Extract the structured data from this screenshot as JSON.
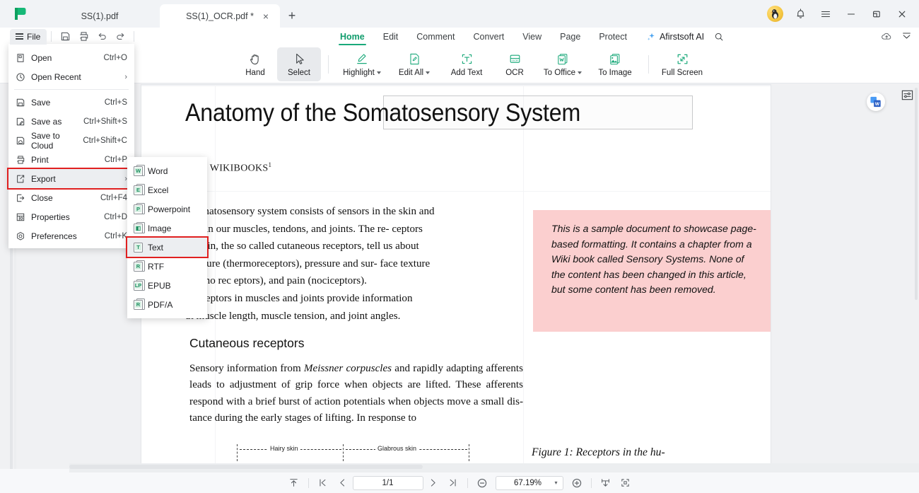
{
  "app": {
    "logo_name": "afirstsoft-logo"
  },
  "tabs": [
    {
      "label": "SS(1).pdf",
      "active": false
    },
    {
      "label": "SS(1)_OCR.pdf *",
      "active": true
    }
  ],
  "tab_new_label": "+",
  "tab_close_label": "×",
  "window_controls": {
    "minimize": "—",
    "maximize": "❐",
    "close": "×"
  },
  "quick_access": {
    "file_label": "File",
    "buttons": [
      "save-icon",
      "print-icon",
      "undo-icon",
      "redo-icon"
    ]
  },
  "menubar": {
    "items": [
      {
        "label": "Home",
        "active": true
      },
      {
        "label": "Edit",
        "active": false
      },
      {
        "label": "Comment",
        "active": false
      },
      {
        "label": "Convert",
        "active": false
      },
      {
        "label": "View",
        "active": false
      },
      {
        "label": "Page",
        "active": false
      },
      {
        "label": "Protect",
        "active": false
      }
    ],
    "ai_label": "Afirstsoft AI"
  },
  "ribbon": {
    "items": [
      {
        "label": "Hand",
        "icon": "hand-icon",
        "caret": false,
        "selected": false
      },
      {
        "label": "Select",
        "icon": "cursor-icon",
        "caret": false,
        "selected": true
      },
      {
        "label": "Highlight",
        "icon": "highlighter-icon",
        "caret": true,
        "selected": false
      },
      {
        "label": "Edit All",
        "icon": "edit-all-icon",
        "caret": true,
        "selected": false
      },
      {
        "label": "Add Text",
        "icon": "add-text-icon",
        "caret": false,
        "selected": false
      },
      {
        "label": "OCR",
        "icon": "ocr-icon",
        "caret": false,
        "selected": false
      },
      {
        "label": "To Office",
        "icon": "to-office-icon",
        "caret": true,
        "selected": false
      },
      {
        "label": "To Image",
        "icon": "to-image-icon",
        "caret": false,
        "selected": false
      },
      {
        "label": "Full Screen",
        "icon": "full-screen-icon",
        "caret": false,
        "selected": false
      }
    ]
  },
  "file_menu": {
    "items": [
      {
        "label": "Open",
        "accel": "Ctrl+O",
        "icon": "open-icon",
        "arrow": false,
        "highlighted": false
      },
      {
        "label": "Open Recent",
        "accel": "",
        "icon": "recent-icon",
        "arrow": true,
        "highlighted": false
      },
      {
        "label": "Save",
        "accel": "Ctrl+S",
        "icon": "save-icon",
        "arrow": false,
        "highlighted": false
      },
      {
        "label": "Save as",
        "accel": "Ctrl+Shift+S",
        "icon": "save-as-icon",
        "arrow": false,
        "highlighted": false
      },
      {
        "label": "Save to Cloud",
        "accel": "Ctrl+Shift+C",
        "icon": "save-cloud-icon",
        "arrow": false,
        "highlighted": false
      },
      {
        "label": "Print",
        "accel": "Ctrl+P",
        "icon": "print-icon",
        "arrow": false,
        "highlighted": false
      },
      {
        "label": "Export",
        "accel": "",
        "icon": "export-icon",
        "arrow": true,
        "highlighted": true
      },
      {
        "label": "Close",
        "accel": "Ctrl+F4",
        "icon": "close-doc-icon",
        "arrow": false,
        "highlighted": false
      },
      {
        "label": "Properties",
        "accel": "Ctrl+D",
        "icon": "properties-icon",
        "arrow": false,
        "highlighted": false
      },
      {
        "label": "Preferences",
        "accel": "Ctrl+K",
        "icon": "preferences-icon",
        "arrow": false,
        "highlighted": false
      }
    ],
    "arrow_glyph": "›"
  },
  "export_submenu": {
    "items": [
      {
        "label": "Word",
        "glyph": "W",
        "highlighted": false
      },
      {
        "label": "Excel",
        "glyph": "E",
        "highlighted": false
      },
      {
        "label": "Powerpoint",
        "glyph": "P",
        "highlighted": false
      },
      {
        "label": "Image",
        "glyph": "◧",
        "highlighted": false
      },
      {
        "label": "Text",
        "glyph": "T",
        "highlighted": true
      },
      {
        "label": "RTF",
        "glyph": "R",
        "highlighted": false
      },
      {
        "label": "EPUB",
        "glyph": "LP",
        "highlighted": false
      },
      {
        "label": "PDF/A",
        "glyph": "R",
        "highlighted": false
      }
    ]
  },
  "document": {
    "title": "Anatomy of the Somatosensory System",
    "source": "OM WIKIBOOKS",
    "source_sup": "1",
    "paragraph1_lines": [
      "r somatosensory system consists of sensors in the skin and",
      "sors in our muscles, tendons, and joints. The re- ceptors",
      "he skin, the so called cutaneous receptors, tell us about",
      "perature (thermoreceptors), pressure and sur- face texture",
      "echano rec eptors), and pain (nociceptors)."
    ],
    "paragraph2_lines": [
      "e receptors in muscles and joints provide information",
      "ut muscle length, muscle tension, and joint angles."
    ],
    "section_heading": "Cutaneous receptors",
    "section_body": "Sensory information from Meissner corpuscles and rapidly adapting afferents leads to adjustment of grip force when objects are lifted. These afferents respond with a brief burst of action potentials when objects move a small dis-tance during the early stages of lifting. In response to",
    "section_body_italic": "Meissner corpuscles",
    "note_text": "This is a sample document to showcase page-based formatting. It contains a chapter from a Wiki book called Sensory Systems. None of the content has been changed in this article, but some content has been removed.",
    "note_color": "#fbcfcf",
    "figure_caption": "Figure 1: Receptors in the hu-",
    "diagram_labels": [
      "Hairy skin",
      "Glabrous skin"
    ]
  },
  "statusbar": {
    "page_value": "1/1",
    "zoom_value": "67.19%",
    "buttons": [
      "scroll-top-icon",
      "first-page-icon",
      "prev-page-icon",
      "next-page-icon",
      "last-page-icon",
      "zoom-out-icon",
      "zoom-in-icon",
      "fit-width-icon",
      "fit-page-icon"
    ],
    "zoom_caret": "▾"
  },
  "colors": {
    "accent_green": "#109c6c",
    "highlight_red": "#e02020",
    "tab_active_bg": "#ffffff",
    "note_pink": "#fbcfcf"
  }
}
